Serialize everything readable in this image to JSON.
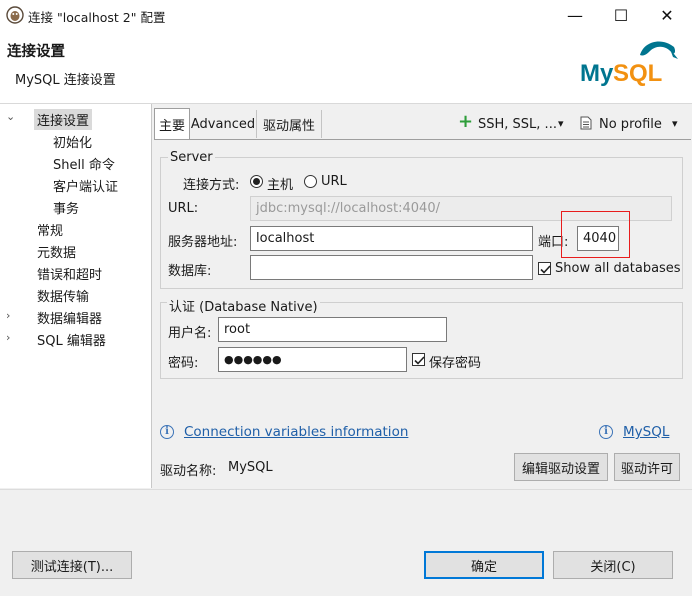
{
  "window": {
    "title": "连接 \"localhost 2\" 配置",
    "minimize_glyph": "—",
    "maximize_glyph": "☐",
    "close_glyph": "✕"
  },
  "header": {
    "title": "连接设置",
    "subtitle": "MySQL 连接设置",
    "logo_text": "MySQL",
    "logo_color": "#00758f",
    "logo_accent_color": "#f29111"
  },
  "tree": {
    "items": [
      {
        "label": "连接设置",
        "selected": true
      },
      {
        "label": "初始化"
      },
      {
        "label": "Shell 命令"
      },
      {
        "label": "客户端认证"
      },
      {
        "label": "事务"
      },
      {
        "label": "常规"
      },
      {
        "label": "元数据"
      },
      {
        "label": "错误和超时"
      },
      {
        "label": "数据传输"
      },
      {
        "label": "数据编辑器",
        "expandable": true
      },
      {
        "label": "SQL 编辑器",
        "expandable": true
      }
    ],
    "expand_glyph": "›",
    "collapse_glyph": "⌄"
  },
  "tabs": {
    "items": [
      {
        "label": "主要",
        "active": true
      },
      {
        "label": "Advanced"
      },
      {
        "label": "驱动属性"
      }
    ],
    "ssh_label": "SSH, SSL, ...",
    "profile_label": "No profile",
    "dropdown_glyph": "▾",
    "plus_glyph": "+"
  },
  "server": {
    "group_label": "Server",
    "connect_method_label": "连接方式:",
    "radio_host": "主机",
    "radio_url": "URL",
    "url_label": "URL:",
    "url_value": "jdbc:mysql://localhost:4040/",
    "host_label": "服务器地址:",
    "host_value": "localhost",
    "port_label": "端口:",
    "port_value": "4040",
    "db_label": "数据库:",
    "db_value": "",
    "show_all_label": "Show all databases"
  },
  "auth": {
    "group_label": "认证 (Database Native)",
    "user_label": "用户名:",
    "user_value": "root",
    "password_label": "密码:",
    "password_value": "●●●●●●",
    "save_password_label": "保存密码"
  },
  "links": {
    "conn_vars": "Connection variables information",
    "mysql": "MySQL"
  },
  "driver": {
    "label": "驱动名称:",
    "value": "MySQL",
    "edit_button": "编辑驱动设置",
    "license_button": "驱动许可"
  },
  "footer": {
    "test_button": "测试连接(T)...",
    "ok_button": "确定",
    "close_button": "关闭(C)"
  },
  "colors": {
    "link": "#1f5fa8",
    "highlight": "#e81c1c",
    "plus_green": "#2e9e3a",
    "default_button_border": "#0078d7"
  }
}
